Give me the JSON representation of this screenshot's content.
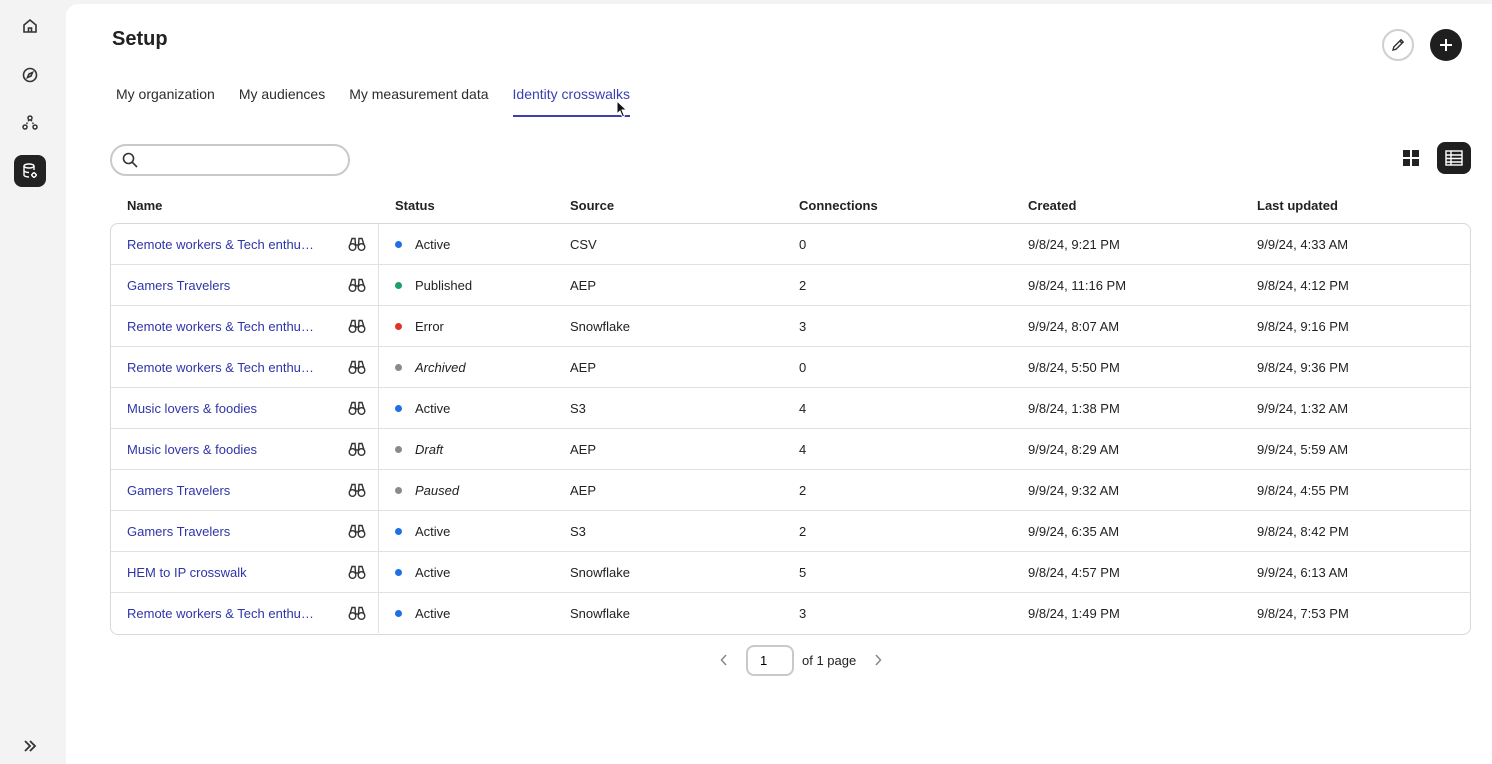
{
  "page": {
    "title": "Setup"
  },
  "rail": {
    "items": [
      {
        "icon": "home-icon"
      },
      {
        "icon": "compass-icon"
      },
      {
        "icon": "nodes-icon"
      },
      {
        "icon": "database-settings-icon",
        "active": true
      }
    ],
    "expand_icon": "chevrons-right-icon"
  },
  "toolbar": {
    "edit_icon": "pencil-icon",
    "add_icon": "plus-icon"
  },
  "tabs": [
    {
      "label": "My organization"
    },
    {
      "label": "My audiences"
    },
    {
      "label": "My measurement data"
    },
    {
      "label": "Identity crosswalks",
      "active": true
    }
  ],
  "search": {
    "placeholder": "",
    "value": ""
  },
  "table": {
    "headers": {
      "name": "Name",
      "status": "Status",
      "source": "Source",
      "connections": "Connections",
      "created": "Created",
      "updated": "Last updated"
    },
    "status_colors": {
      "Active": "#1f6fe5",
      "Published": "#1e9e6a",
      "Error": "#e0342b",
      "Archived": "#8a8a8a",
      "Draft": "#8a8a8a",
      "Paused": "#8a8a8a"
    },
    "rows": [
      {
        "name": "Remote workers & Tech enthus...",
        "status": "Active",
        "source": "CSV",
        "connections": "0",
        "created": "9/8/24, 9:21 PM",
        "updated": "9/9/24, 4:33 AM"
      },
      {
        "name": "Gamers Travelers",
        "status": "Published",
        "source": "AEP",
        "connections": "2",
        "created": "9/8/24, 11:16 PM",
        "updated": "9/8/24, 4:12 PM"
      },
      {
        "name": "Remote workers & Tech enthus...",
        "status": "Error",
        "source": "Snowflake",
        "connections": "3",
        "created": "9/9/24, 8:07 AM",
        "updated": "9/8/24, 9:16 PM"
      },
      {
        "name": "Remote workers & Tech enthus...",
        "status": "Archived",
        "source": "AEP",
        "connections": "0",
        "created": "9/8/24, 5:50 PM",
        "updated": "9/8/24, 9:36 PM"
      },
      {
        "name": "Music lovers & foodies",
        "status": "Active",
        "source": "S3",
        "connections": "4",
        "created": "9/8/24, 1:38 PM",
        "updated": "9/9/24, 1:32 AM"
      },
      {
        "name": "Music lovers & foodies",
        "status": "Draft",
        "source": "AEP",
        "connections": "4",
        "created": "9/9/24, 8:29 AM",
        "updated": "9/9/24, 5:59 AM"
      },
      {
        "name": "Gamers Travelers",
        "status": "Paused",
        "source": "AEP",
        "connections": "2",
        "created": "9/9/24, 9:32 AM",
        "updated": "9/8/24, 4:55 PM"
      },
      {
        "name": "Gamers Travelers",
        "status": "Active",
        "source": "S3",
        "connections": "2",
        "created": "9/9/24, 6:35 AM",
        "updated": "9/8/24, 8:42 PM"
      },
      {
        "name": "HEM to IP crosswalk",
        "status": "Active",
        "source": "Snowflake",
        "connections": "5",
        "created": "9/8/24, 4:57 PM",
        "updated": "9/9/24, 6:13 AM"
      },
      {
        "name": "Remote workers & Tech enthus...",
        "status": "Active",
        "source": "Snowflake",
        "connections": "3",
        "created": "9/8/24, 1:49 PM",
        "updated": "9/8/24, 7:53 PM"
      }
    ],
    "italic_statuses": [
      "Archived",
      "Draft",
      "Paused"
    ]
  },
  "pagination": {
    "current": "1",
    "total_text": "of 1 page"
  }
}
